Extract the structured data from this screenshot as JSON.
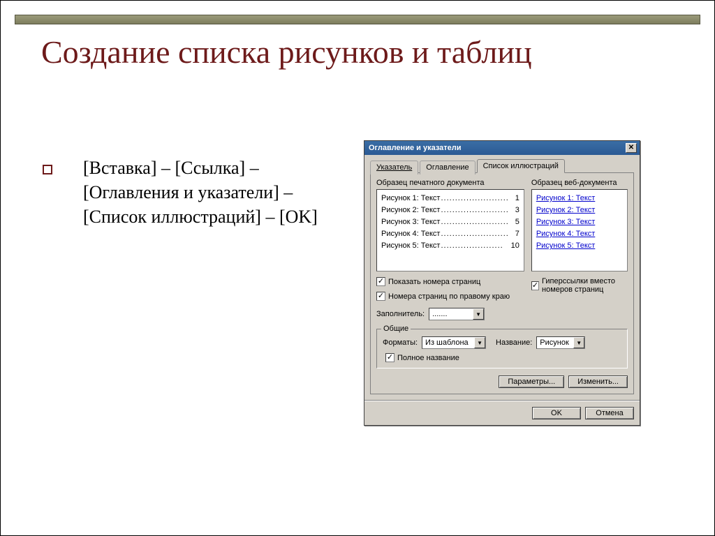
{
  "slide": {
    "title": "Создание списка рисунков и таблиц",
    "instruction": "[Вставка] – [Ссылка] – [Оглавления и указатели] – [Список иллюстраций] – [OK]"
  },
  "dialog": {
    "title": "Оглавление и указатели",
    "tabs": [
      "Указатель",
      "Оглавление",
      "Список иллюстраций"
    ],
    "active_tab": 2,
    "print_preview_label": "Образец печатного документа",
    "web_preview_label": "Образец веб-документа",
    "print_items": [
      {
        "text": "Рисунок 1: Текст",
        "page": "1"
      },
      {
        "text": "Рисунок 2: Текст",
        "page": "3"
      },
      {
        "text": "Рисунок 3: Текст",
        "page": "5"
      },
      {
        "text": "Рисунок 4: Текст",
        "page": "7"
      },
      {
        "text": "Рисунок 5: Текст",
        "page": "10"
      }
    ],
    "web_items": [
      "Рисунок 1: Текст",
      "Рисунок 2: Текст",
      "Рисунок 3: Текст",
      "Рисунок 4: Текст",
      "Рисунок 5: Текст"
    ],
    "chk_show_pages": "Показать номера страниц",
    "chk_right_align": "Номера страниц по правому краю",
    "chk_hyperlinks": "Гиперссылки вместо номеров страниц",
    "leader_label": "Заполнитель:",
    "leader_value": ".......",
    "group_label": "Общие",
    "formats_label": "Форматы:",
    "formats_value": "Из шаблона",
    "caption_label": "Название:",
    "caption_value": "Рисунок",
    "chk_full_caption": "Полное название",
    "btn_options": "Параметры...",
    "btn_modify": "Изменить...",
    "btn_ok": "OK",
    "btn_cancel": "Отмена"
  }
}
